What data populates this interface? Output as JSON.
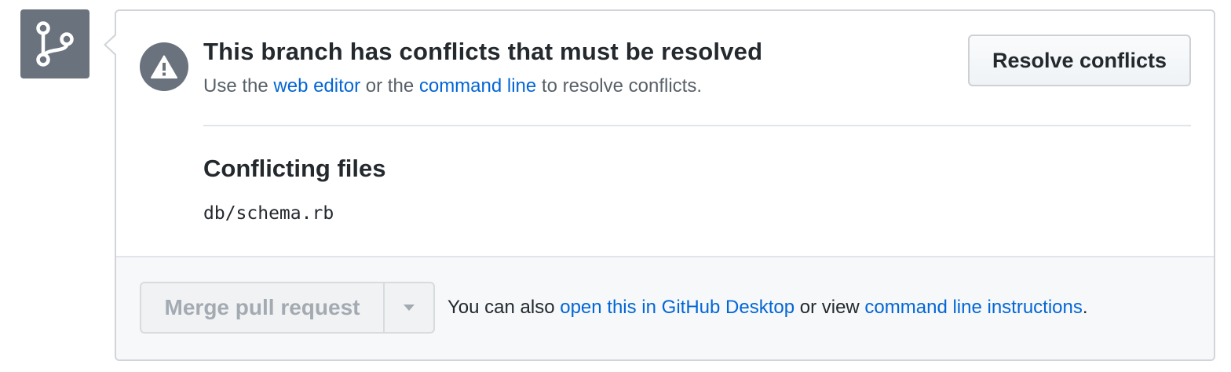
{
  "icons": {
    "branch": "git-branch-icon",
    "alert": "alert-icon",
    "dropdown": "triangle-down-icon"
  },
  "conflict": {
    "title": "This branch has conflicts that must be resolved",
    "desc_prefix": "Use the ",
    "web_editor_link": "web editor",
    "desc_middle": " or the ",
    "command_line_link": "command line",
    "desc_suffix": " to resolve conflicts.",
    "resolve_button": "Resolve conflicts"
  },
  "files": {
    "heading": "Conflicting files",
    "items": [
      "db/schema.rb"
    ]
  },
  "merge": {
    "button_label": "Merge pull request",
    "text_prefix": "You can also ",
    "desktop_link": "open this in GitHub Desktop",
    "text_middle": " or view ",
    "instructions_link": "command line instructions",
    "text_suffix": "."
  },
  "colors": {
    "link": "#0366d6",
    "icon_bg": "#6a737d",
    "border": "#d1d5da",
    "footer_bg": "#f6f8fa"
  }
}
